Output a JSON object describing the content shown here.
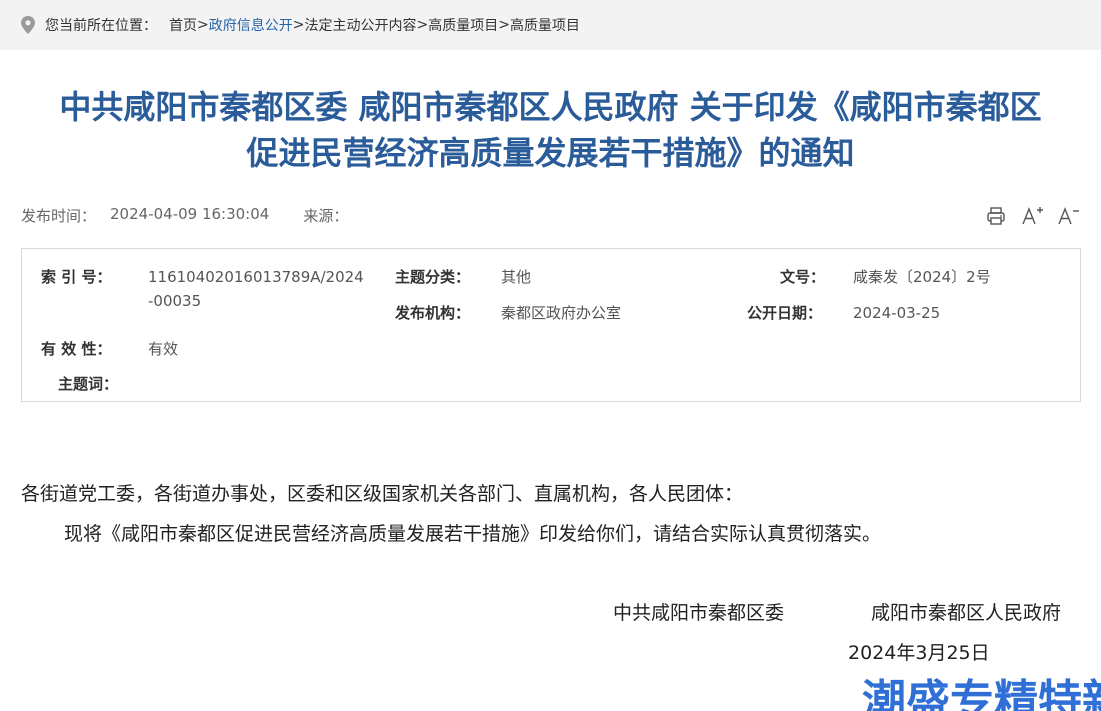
{
  "breadcrumb": {
    "prefix": "您当前所在位置：",
    "items": [
      "首页",
      "政府信息公开",
      "法定主动公开内容",
      "高质量项目",
      "高质量项目"
    ],
    "separator": ">"
  },
  "title": {
    "line1": "中共咸阳市秦都区委 咸阳市秦都区人民政府 关于印发《咸阳市秦都区",
    "line2": "促进民营经济高质量发展若干措施》的通知"
  },
  "meta": {
    "publish_label": "发布时间：",
    "publish_value": "2024-04-09 16:30:04",
    "source_label": "来源："
  },
  "tools": {
    "print": "print-icon",
    "font_up": "A+",
    "font_down": "A-"
  },
  "info": {
    "index_label": "索 引 号：",
    "index_value_1": "11610402016013789A/2024",
    "index_value_2": "-00035",
    "topic_label": "主题分类：",
    "topic_value": "其他",
    "doc_label": "文号：",
    "doc_value": "咸秦发〔2024〕2号",
    "org_label": "发布机构：",
    "org_value": "秦都区政府办公室",
    "date_label": "公开日期：",
    "date_value": "2024-03-25",
    "validity_label": "有 效 性：",
    "validity_value": "有效",
    "keywords_label": "主题词："
  },
  "body": {
    "salutation": "各街道党工委，各街道办事处，区委和区级国家机关各部门、直属机构，各人民团体：",
    "paragraph": "现将《咸阳市秦都区促进民营经济高质量发展若干措施》印发给你们，请结合实际认真贯彻落实。",
    "sign_org1": "中共咸阳市秦都区委",
    "sign_org2": "咸阳市秦都区人民政府",
    "sign_date": "2024年3月25日"
  },
  "watermark": {
    "text": "潮盛专精特新",
    "color": "#2f6fd6"
  },
  "colors": {
    "title": "#2b5c9a",
    "link": "#2a64a8",
    "breadcrumb_bg": "#f3f3f3",
    "box_border": "#d9d9d9"
  }
}
